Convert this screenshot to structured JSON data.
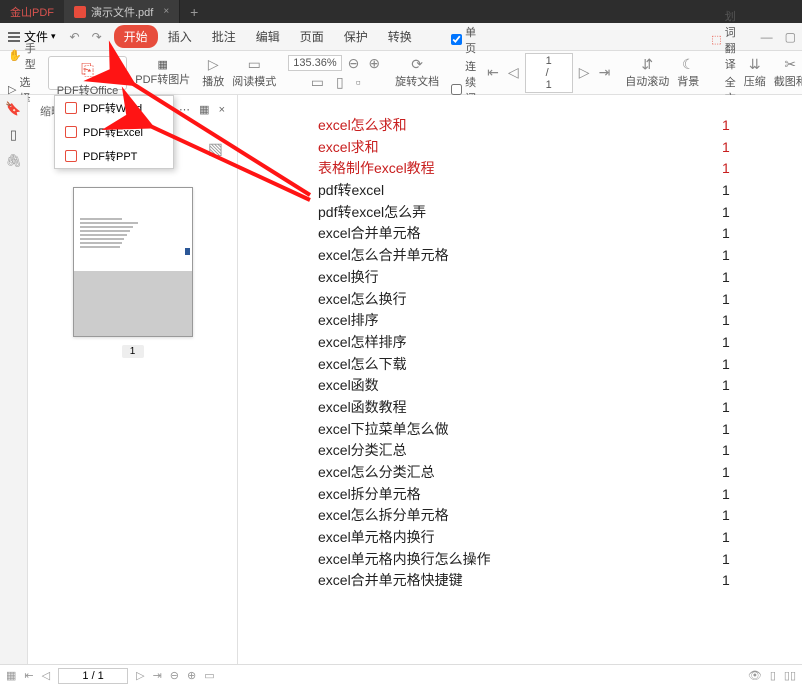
{
  "titlebar": {
    "app_name": "金山PDF",
    "tab_title": "演示文件.pdf",
    "close": "×",
    "plus": "+"
  },
  "menubar": {
    "file": "文件",
    "items": [
      "开始",
      "插入",
      "批注",
      "编辑",
      "页面",
      "保护",
      "转换"
    ]
  },
  "toolbar": {
    "hand": "手型",
    "select": "选择",
    "pdf_to_office": "PDF转Office",
    "pdf_to_image": "PDF转图片",
    "play": "播放",
    "read_mode": "阅读模式",
    "zoom_value": "135.36%",
    "rotate": "旋转文档",
    "single_page": "单页",
    "continuous_read": "连续阅读",
    "auto_scroll": "自动滚动",
    "background": "背景",
    "page_value": "1 / 1",
    "sel_translate": "划词翻译",
    "full_translate": "全文翻译",
    "compress": "压缩",
    "crop": "截图和"
  },
  "dropdown": {
    "items": [
      {
        "label": "PDF转Word"
      },
      {
        "label": "PDF转Excel"
      },
      {
        "label": "PDF转PPT"
      }
    ]
  },
  "thumb": {
    "label": "缩略",
    "close": "×",
    "page_num": "1"
  },
  "doc": {
    "rows": [
      {
        "t": "excel怎么求和",
        "n": "1",
        "red": true
      },
      {
        "t": "excel求和",
        "n": "1",
        "red": true
      },
      {
        "t": "表格制作excel教程",
        "n": "1",
        "red": true
      },
      {
        "t": "pdf转excel",
        "n": "1"
      },
      {
        "t": "pdf转excel怎么弄",
        "n": "1"
      },
      {
        "t": "excel合并单元格",
        "n": "1"
      },
      {
        "t": "excel怎么合并单元格",
        "n": "1"
      },
      {
        "t": "excel换行",
        "n": "1"
      },
      {
        "t": "excel怎么换行",
        "n": "1"
      },
      {
        "t": "excel排序",
        "n": "1"
      },
      {
        "t": "excel怎样排序",
        "n": "1"
      },
      {
        "t": "excel怎么下载",
        "n": "1"
      },
      {
        "t": "excel函数",
        "n": "1"
      },
      {
        "t": "excel函数教程",
        "n": "1"
      },
      {
        "t": "excel下拉菜单怎么做",
        "n": "1"
      },
      {
        "t": "excel分类汇总",
        "n": "1"
      },
      {
        "t": "excel怎么分类汇总",
        "n": "1"
      },
      {
        "t": "excel拆分单元格",
        "n": "1"
      },
      {
        "t": "excel怎么拆分单元格",
        "n": "1"
      },
      {
        "t": "excel单元格内换行",
        "n": "1"
      },
      {
        "t": "excel单元格内换行怎么操作",
        "n": "1"
      },
      {
        "t": "excel合并单元格快捷键",
        "n": "1"
      }
    ]
  },
  "status": {
    "page": "1 / 1"
  }
}
